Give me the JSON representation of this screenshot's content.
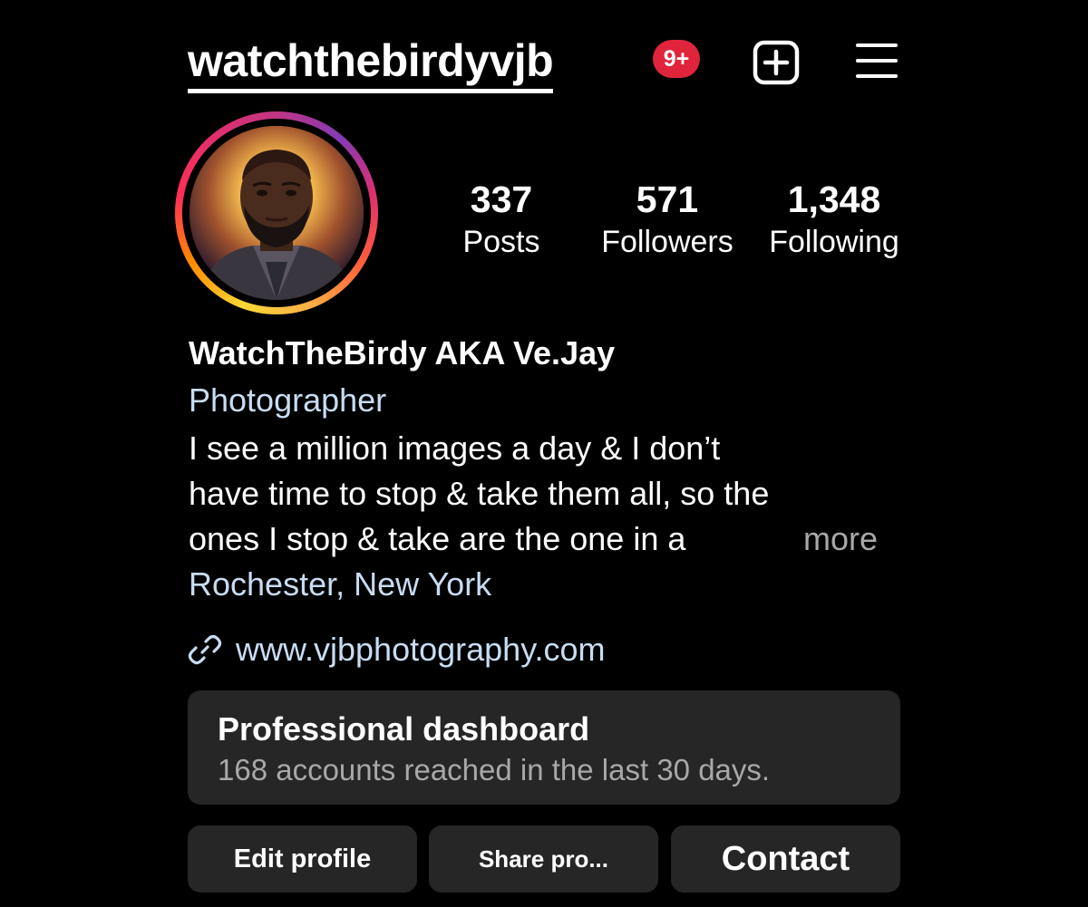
{
  "header": {
    "username": "watchthebirdyvjb",
    "notification_badge": "9+",
    "create_icon": "plus-square-icon",
    "menu_icon": "hamburger-menu-icon"
  },
  "stats": {
    "posts": {
      "value": "337",
      "label": "Posts"
    },
    "followers": {
      "value": "571",
      "label": "Followers"
    },
    "following": {
      "value": "1,348",
      "label": "Following"
    }
  },
  "profile": {
    "display_name": "WatchTheBirdy AKA Ve.Jay",
    "category": "Photographer",
    "bio_lines": [
      "I see a million images a day & I don’t",
      "have time to stop & take them all, so the",
      "ones I stop & take are the one in a"
    ],
    "more_label": "more",
    "location": "Rochester, New York",
    "website": "www.vjbphotography.com",
    "link_icon": "link-icon"
  },
  "dashboard": {
    "title": "Professional dashboard",
    "subtitle": "168 accounts reached in the last 30 days."
  },
  "actions": {
    "edit_label": "Edit profile",
    "share_label": "Share pro...",
    "contact_label": "Contact"
  },
  "colors": {
    "background": "#000000",
    "card": "#262626",
    "link_text": "#c8dcf2",
    "muted_text": "#a8a8a8",
    "badge": "#e0243c"
  }
}
